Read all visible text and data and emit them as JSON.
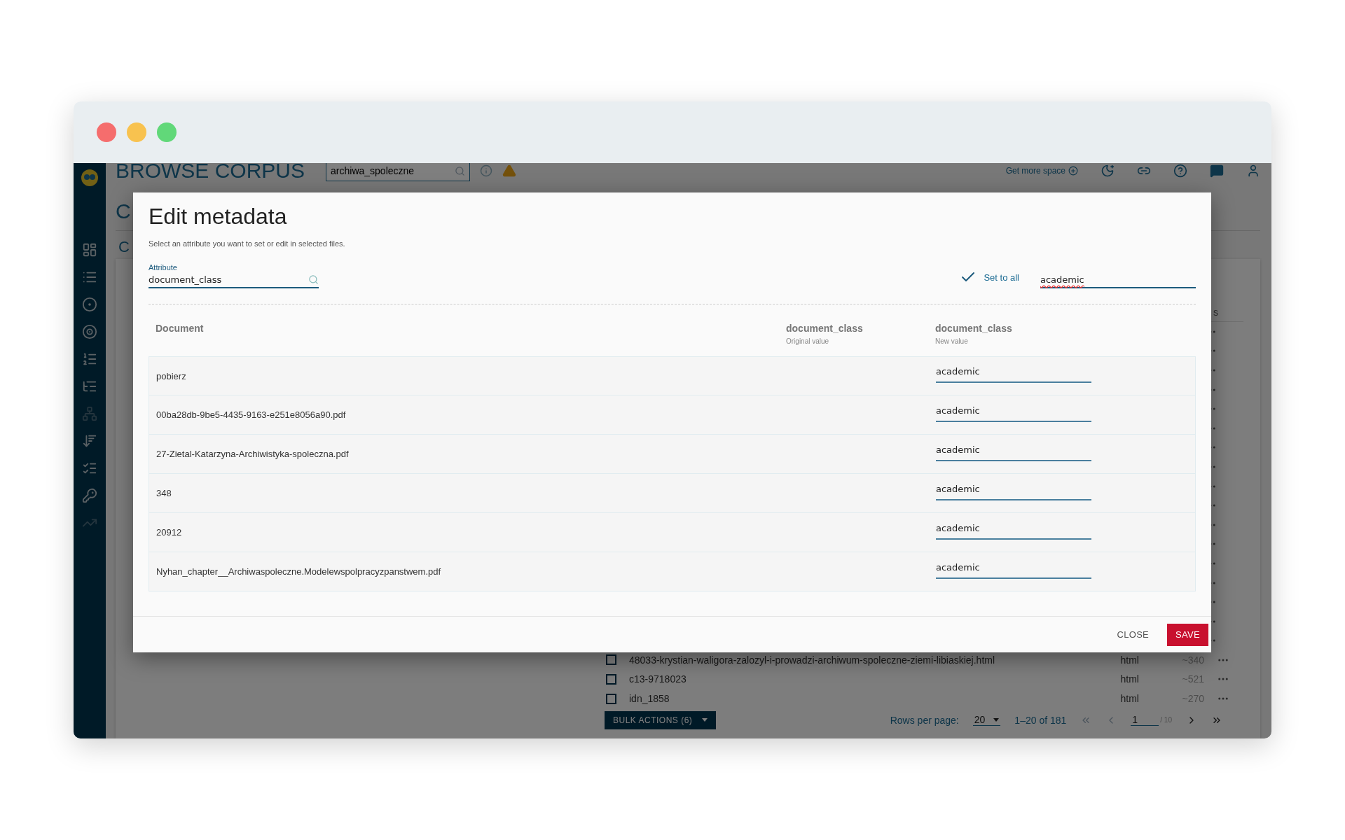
{
  "app": {
    "title": "BROWSE CORPUS",
    "corpus_search": {
      "value": "archiwa_spoleczne"
    },
    "header_link": "Get more space",
    "page_heading": "C",
    "section_heading": "C",
    "sidebar_items": [
      {
        "disabled": false
      },
      {
        "disabled": false
      },
      {
        "disabled": false
      },
      {
        "disabled": false
      },
      {
        "disabled": false
      },
      {
        "disabled": false
      },
      {
        "disabled": true
      },
      {
        "disabled": false
      },
      {
        "disabled": false
      },
      {
        "disabled": false
      },
      {
        "disabled": true
      }
    ],
    "table": {
      "column_fragment": "s",
      "rows": [
        {
          "name": "48033-krystian-waligora-zalozyl-i-prowadzi-archiwum-spoleczne-ziemi-libiaskiej.html",
          "type": "html",
          "count": "~340",
          "checked": false
        },
        {
          "name": "c13-9718023",
          "type": "html",
          "count": "~521",
          "checked": false
        },
        {
          "name": "idn_1858",
          "type": "html",
          "count": "~270",
          "checked": false
        }
      ]
    },
    "bulk_actions": "BULK ACTIONS (6)",
    "pagination": {
      "rows_label": "Rows per page:",
      "rows_per_page": "20",
      "range": "1–20 of 181",
      "page": "1",
      "page_total": "/ 10"
    }
  },
  "dialog": {
    "title": "Edit metadata",
    "subtitle": "Select an attribute you want to set or edit in selected files.",
    "attribute": {
      "label": "Attribute",
      "value": "document_class"
    },
    "set_to_all": {
      "label": "Set to all",
      "checked": true,
      "value": "academic"
    },
    "columns": [
      {
        "title": "Document"
      },
      {
        "title": "document_class",
        "subtitle": "Original value"
      },
      {
        "title": "document_class",
        "subtitle": "New value"
      }
    ],
    "rows": [
      {
        "document": "pobierz",
        "new_value": "academic"
      },
      {
        "document": "00ba28db-9be5-4435-9163-e251e8056a90.pdf",
        "new_value": "academic"
      },
      {
        "document": "27-Zietal-Katarzyna-Archiwistyka-spoleczna.pdf",
        "new_value": "academic"
      },
      {
        "document": "348",
        "new_value": "academic"
      },
      {
        "document": "20912",
        "new_value": "academic"
      },
      {
        "document": "Nyhan_chapter__Archiwaspoleczne.Modelewspolpracyzpanstwem.pdf",
        "new_value": "academic"
      }
    ],
    "buttons": [
      {
        "kind": "text",
        "label": "CLOSE"
      },
      {
        "kind": "primary",
        "label": "SAVE"
      }
    ]
  }
}
